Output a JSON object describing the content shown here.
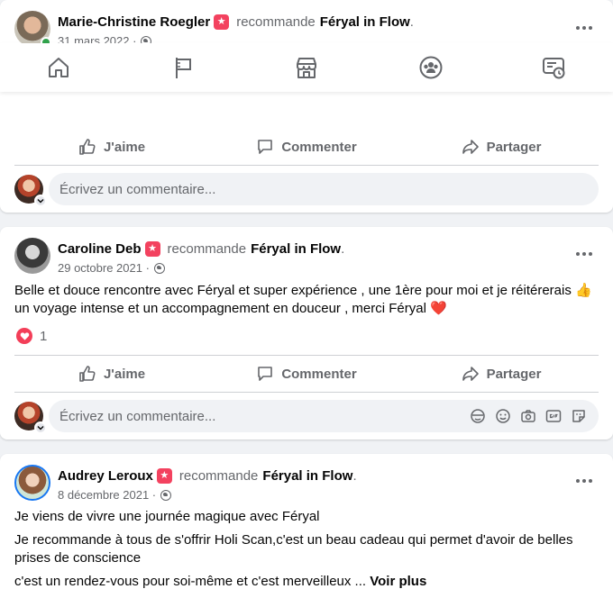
{
  "nav": {
    "tabs": [
      {
        "name": "home-icon"
      },
      {
        "name": "flag-icon"
      },
      {
        "name": "marketplace-icon"
      },
      {
        "name": "groups-icon"
      },
      {
        "name": "gaming-icon"
      }
    ]
  },
  "posts": [
    {
      "author": "Marie-Christine Roegler",
      "recommends": "recommande",
      "page": "Féryal in Flow",
      "date": "31 mars 2022 ·",
      "actions": {
        "like": "J'aime",
        "comment": "Commenter",
        "share": "Partager"
      }
    },
    {
      "author": "Caroline Deb",
      "recommends": "recommande",
      "page": "Féryal in Flow",
      "date": "29 octobre 2021 ·",
      "text_line1": "Belle et douce rencontre avec Féryal et super expérience , une 1ère pour moi et je réitérerais",
      "text_line2": "un voyage intense et un accompagnement en douceur , merci Féryal",
      "emoji_thumb": "👍",
      "emoji_heart": "❤️",
      "reaction_count": "1",
      "actions": {
        "like": "J'aime",
        "comment": "Commenter",
        "share": "Partager"
      }
    },
    {
      "author": "Audrey Leroux",
      "recommends": "recommande",
      "page": "Féryal in Flow",
      "date": "8 décembre 2021 ·",
      "para1": "Je viens de vivre une journée magique avec Féryal",
      "para2": "Je recommande à tous de s'offrir Holi Scan,c'est un beau cadeau qui permet d'avoir de belles prises de conscience",
      "para3": "c'est un rendez-vous  pour soi-même et c'est merveilleux ...",
      "see_more": "Voir plus"
    }
  ],
  "comment_box": {
    "placeholder": "Écrivez un commentaire..."
  },
  "colors": {
    "accent": "#1877f2",
    "recommend_badge": "#f3425f",
    "secondary_text": "#65676b",
    "background": "#f0f2f5"
  }
}
